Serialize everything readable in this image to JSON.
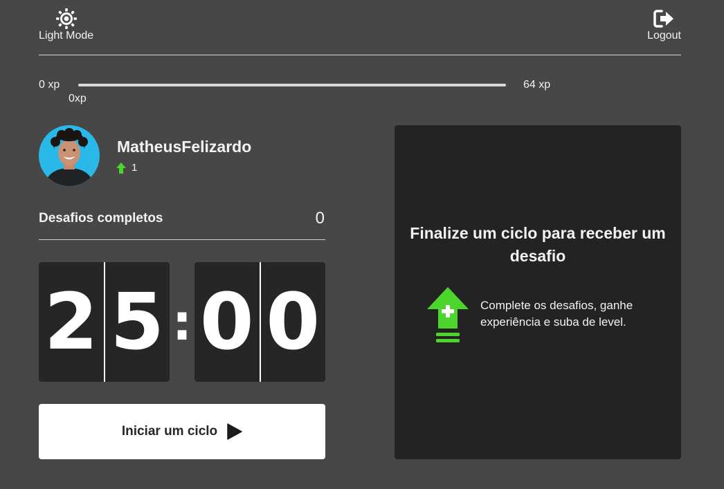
{
  "header": {
    "light_mode_label": "Light Mode",
    "logout_label": "Logout"
  },
  "xp": {
    "min_label": "0 xp",
    "max_label": "64 xp",
    "current_label": "0xp",
    "progress_fraction": 0
  },
  "profile": {
    "username": "MatheusFelizardo",
    "level": "1"
  },
  "challenges": {
    "completed_label": "Desafios completos",
    "completed_count": "0"
  },
  "countdown": {
    "minute_left": "2",
    "minute_right": "5",
    "separator": ":",
    "second_left": "0",
    "second_right": "0"
  },
  "start_button": {
    "label": "Iniciar um ciclo"
  },
  "challenge_panel": {
    "title": "Finalize um ciclo para receber um desafio",
    "description": "Complete os desafios, ganhe experiência e suba de level."
  },
  "icons": {
    "light_mode": "sun-icon",
    "logout": "logout-icon",
    "level": "level-up-arrow-icon",
    "start": "play-icon",
    "panel": "level-up-icon"
  },
  "colors": {
    "background": "#474747",
    "panel": "#232323",
    "timer_box": "#262626",
    "accent_green": "#4cd62b"
  }
}
